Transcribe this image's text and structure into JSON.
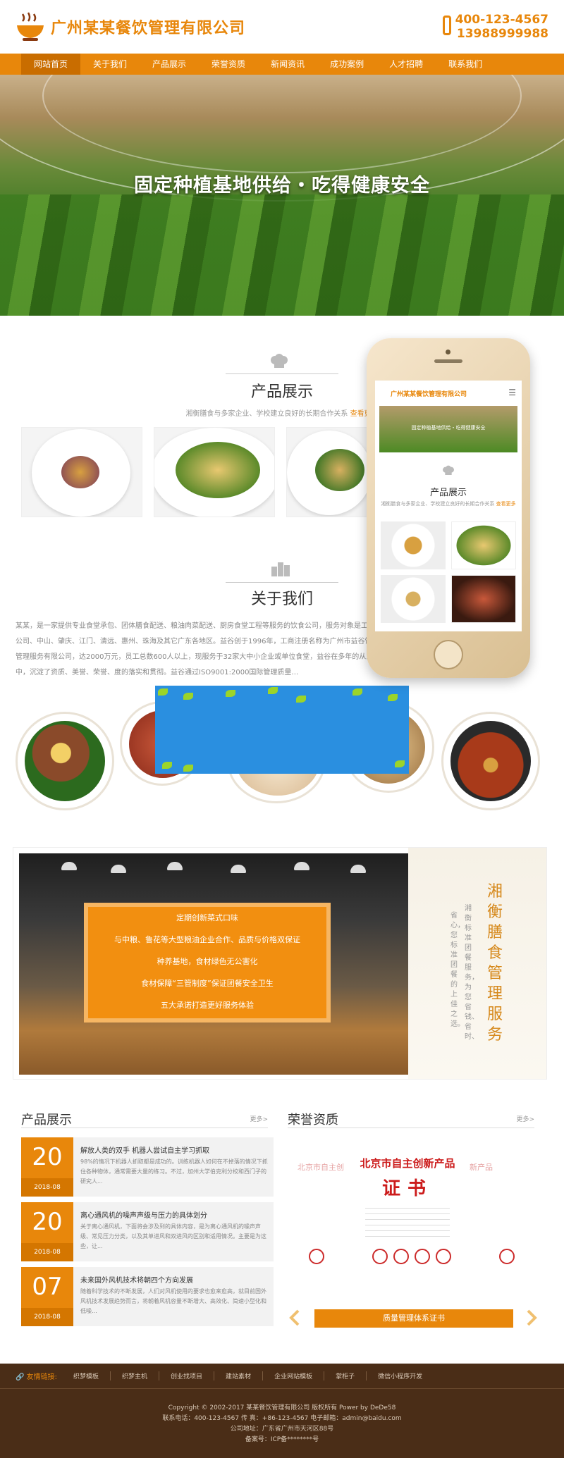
{
  "header": {
    "brand": "广州某某餐饮管理有限公司",
    "phone_line1": "400-123-4567",
    "phone_line2": "13988999988"
  },
  "nav": {
    "items": [
      "网站首页",
      "关于我们",
      "产品展示",
      "荣誉资质",
      "新闻资讯",
      "成功案例",
      "人才招聘",
      "联系我们"
    ]
  },
  "banner": {
    "title": "固定种植基地供给・吃得健康安全"
  },
  "products_section": {
    "title": "产品展示",
    "subtitle": "湘衡膳食与多家企业、学校建立良好的长期合作关系",
    "more": "查看更多"
  },
  "about_section": {
    "title": "关于我们",
    "text": "某某，是一家提供专业食堂承包、团体膳食配送、粮油肉菜配送、厨房食堂工程等服务的饮食公司，服务对象是工厂、公司、中山、肇庆、江门、清远、惠州、珠海及其它广东各地区。益谷创于1996年，工商注册名称为广州市益谷饮食管理服务有限公司，达2000万元，员工总数600人以上，现服务于32家大中小企业或单位食堂，益谷在多年的从业中，沉淀了资质、美誉、荣誉、度的落实和贯彻。益谷通过ISO9001:2000国际管理质量…"
  },
  "phone": {
    "brand": "广州某某餐饮管理有限公司",
    "banner_text": "固定种植基地供给・吃得健康安全",
    "section_title": "产品展示",
    "section_sub": "湘衡膳食与多家企业、学校建立良好的长期合作关系",
    "more": "查看更多"
  },
  "service": {
    "lines": [
      "定期创新菜式口味",
      "与中粮、鲁花等大型粮油企业合作、品质与价格双保证",
      "种养基地，食材绿色无公害化",
      "食材保障“三管制度”保证团餐安全卫生",
      "五大承诺打造更好服务体验"
    ],
    "vertical_title": "湘衡膳食管理服务",
    "vertical_sub1": "湘衡标准团餐服务，为您省钱、省时、",
    "vertical_sub2": "省心，您标准团餐的上佳之选。"
  },
  "news": {
    "title": "产品展示",
    "more": "更多>",
    "items": [
      {
        "day": "20",
        "ym": "2018-08",
        "title": "解放人类的双手 机器人尝试自主学习抓取",
        "desc": "98%的情况下机器人抓取都是成功的。训练机器人如何在不掉落的情况下抓住各种物体，通常需要大量的练习。不过，加州大学伯克利分校和西门子的研究人..."
      },
      {
        "day": "20",
        "ym": "2018-08",
        "title": "离心通风机的噪声声级与压力的具体划分",
        "desc": "关于离心通风机，下面将会涉及到的具体内容，是为离心通风机的噪声声级、常见压力分类，以及其单进风和双进风的区别和适用情况。主要是为这些，让..."
      },
      {
        "day": "07",
        "ym": "2018-08",
        "title": "未来国外风机技术将朝四个方向发展",
        "desc": "随着科学技术的不断发展，人们对风机使用的要求也愈来愈高，就目前国外风机技术发展趋势而言，将朝着风机容量不断增大、高效化、简速小型化和低噪..."
      }
    ]
  },
  "honor": {
    "title": "荣誉资质",
    "more": "更多>",
    "cert_title": "北京市自主创新产品",
    "cert_big": "证书",
    "cert_ghost_left": "北京市自主创",
    "cert_ghost_right": "新产品",
    "button": "质量管理体系证书"
  },
  "links": {
    "label": "友情链接:",
    "items": [
      "织梦模板",
      "织梦主机",
      "创业找项目",
      "建站素材",
      "企业网站模板",
      "掌柜子",
      "微信小程序开发"
    ]
  },
  "footer": {
    "copyright": "Copyright © 2002-2017 某某餐饮管理有限公司 版权所有 Power by DeDe58",
    "contact": "联系电话：400-123-4567 传 真：+86-123-4567 电子邮箱：admin@baidu.com",
    "address": "公司地址：广东省广州市天河区88号",
    "icp": "备案号：ICP备********号"
  },
  "colors": {
    "accent": "#e8870b",
    "footer": "#4a2d17",
    "popup": "#2a8fe0"
  }
}
